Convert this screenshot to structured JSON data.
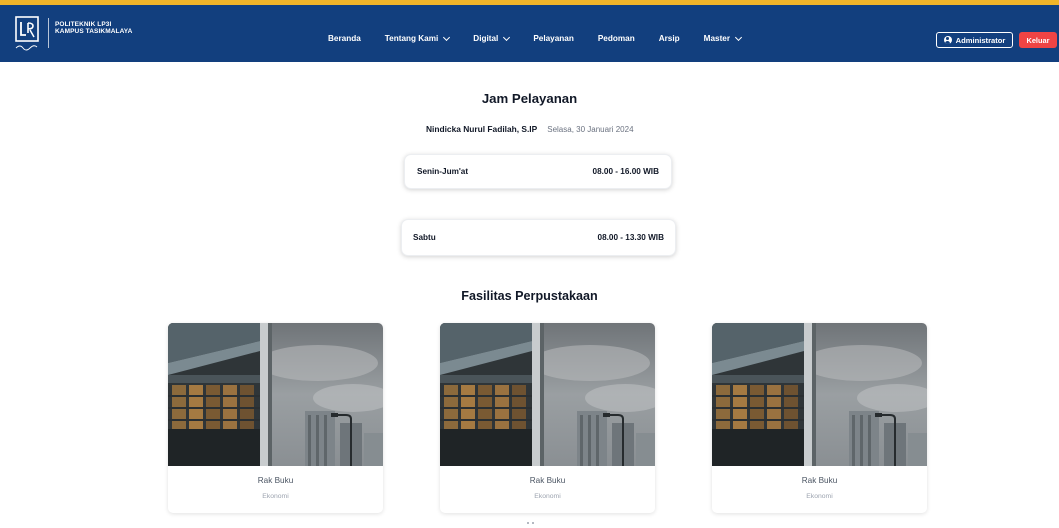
{
  "brand": {
    "line1": "POLITEKNIK LP3I",
    "line2": "KAMPUS TASIKMALAYA",
    "logo_icon": "lp3i-logo-icon"
  },
  "nav": {
    "items": [
      {
        "label": "Beranda",
        "dropdown": false
      },
      {
        "label": "Tentang Kami",
        "dropdown": true
      },
      {
        "label": "Digital",
        "dropdown": true
      },
      {
        "label": "Pelayanan",
        "dropdown": false
      },
      {
        "label": "Pedoman",
        "dropdown": false
      },
      {
        "label": "Arsip",
        "dropdown": false
      },
      {
        "label": "Master",
        "dropdown": true
      }
    ]
  },
  "user": {
    "admin_label": "Administrator",
    "logout_label": "Keluar"
  },
  "service": {
    "title": "Jam Pelayanan",
    "officer": "Nindicka Nurul Fadilah, S.IP",
    "date": "Selasa, 30 Januari 2024",
    "schedules": [
      {
        "day": "Senin-Jum'at",
        "hours": "08.00 - 16.00 WIB"
      },
      {
        "day": "Sabtu",
        "hours": "08.00 - 13.30 WIB"
      }
    ]
  },
  "facilities": {
    "title": "Fasilitas Perpustakaan",
    "cards": [
      {
        "title": "Rak Buku",
        "subtitle": "Ekonomi"
      },
      {
        "title": "Rak Buku",
        "subtitle": "Ekonomi"
      },
      {
        "title": "Rak Buku",
        "subtitle": "Ekonomi"
      }
    ]
  },
  "colors": {
    "navbar": "#123f7e",
    "accent": "#f0b429",
    "logout": "#ef4444"
  }
}
